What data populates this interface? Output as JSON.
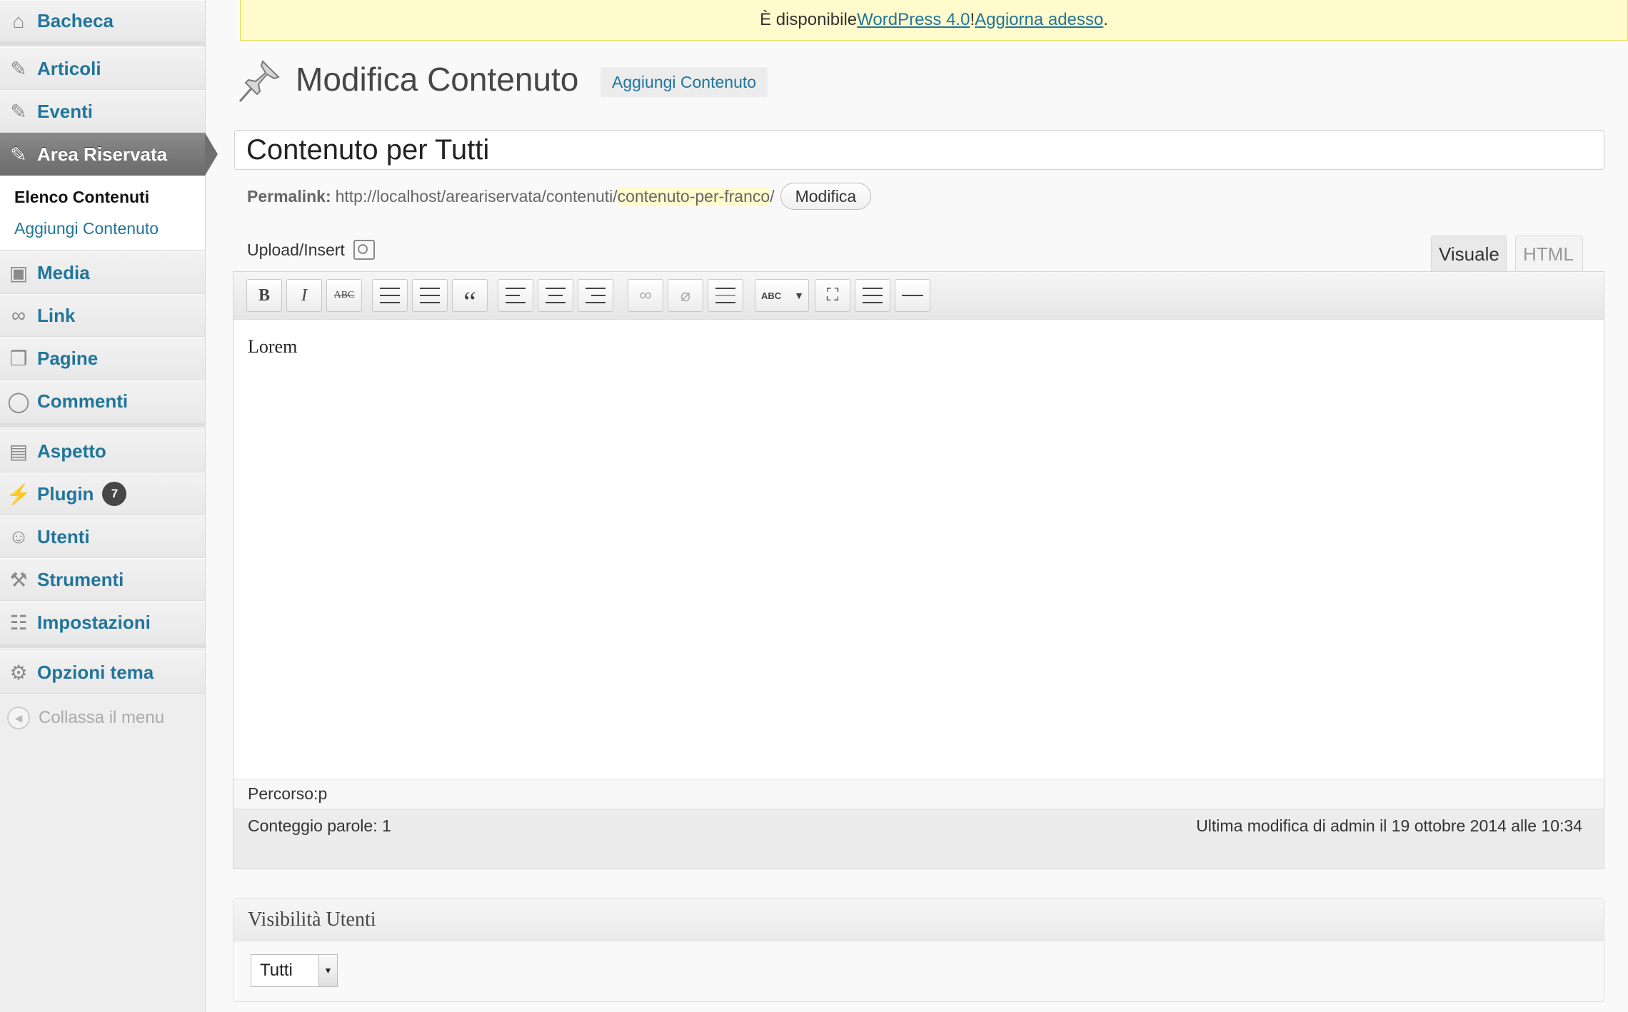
{
  "sidebar": {
    "items": [
      {
        "label": "Bacheca",
        "icon": "home-icon"
      },
      {
        "label": "Articoli",
        "icon": "pushpin-icon"
      },
      {
        "label": "Eventi",
        "icon": "pushpin-icon"
      },
      {
        "label": "Area Riservata",
        "icon": "pushpin-icon"
      },
      {
        "label": "Media",
        "icon": "media-icon"
      },
      {
        "label": "Link",
        "icon": "link-icon"
      },
      {
        "label": "Pagine",
        "icon": "pages-icon"
      },
      {
        "label": "Commenti",
        "icon": "comment-icon"
      },
      {
        "label": "Aspetto",
        "icon": "appearance-icon"
      },
      {
        "label": "Plugin",
        "icon": "plugin-icon",
        "badge": "7"
      },
      {
        "label": "Utenti",
        "icon": "users-icon"
      },
      {
        "label": "Strumenti",
        "icon": "tools-icon"
      },
      {
        "label": "Impostazioni",
        "icon": "settings-icon"
      },
      {
        "label": "Opzioni tema",
        "icon": "gear-icon"
      }
    ],
    "submenu": {
      "current": "Elenco Contenuti",
      "link": "Aggiungi Contenuto"
    },
    "collapse_label": "Collassa il menu"
  },
  "notice": {
    "prefix": "È disponibile ",
    "link1": "WordPress 4.0",
    "middle": "! ",
    "link2": "Aggiorna adesso",
    "suffix": "."
  },
  "header": {
    "title": "Modifica Contenuto",
    "add_new": "Aggiungi Contenuto"
  },
  "post": {
    "title": "Contenuto per Tutti",
    "permalink_label": "Permalink:",
    "permalink_base": "http://localhost/areariservata/contenuti/",
    "permalink_slug": "contenuto-per-franco",
    "permalink_suffix": "/",
    "edit_slug": "Modifica"
  },
  "editor": {
    "upload_label": "Upload/Insert",
    "tab_visual": "Visuale",
    "tab_html": "HTML",
    "content": "Lorem",
    "path_label": "Percorso: ",
    "path_value": "p",
    "word_count": "Conteggio parole: 1",
    "last_edit": "Ultima modifica di admin il 19 ottobre 2014 alle 10:34"
  },
  "toolbar": {
    "bold": "B",
    "italic": "I",
    "strike": "ABC",
    "blockquote": "“",
    "spellcheck": "ABC"
  },
  "metabox": {
    "title": "Visibilità Utenti",
    "select_value": "Tutti"
  }
}
